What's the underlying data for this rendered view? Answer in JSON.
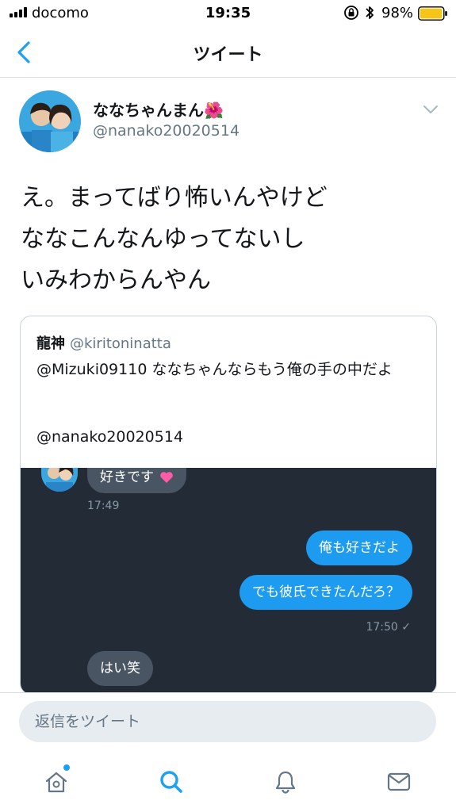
{
  "status_bar": {
    "carrier": "docomo",
    "time": "19:35",
    "battery": "98%",
    "battery_level": 0.98,
    "icons": [
      "signal-icon",
      "lock-rotation-icon",
      "bluetooth-icon",
      "battery-icon"
    ]
  },
  "nav": {
    "title": "ツイート",
    "back_icon": "chevron-left-icon"
  },
  "tweet": {
    "display_name": "ななちゃんまん🌺",
    "handle": "@nanako20020514",
    "lines": [
      "え。まってばり怖いんやけど",
      "ななこんなんゆってないし",
      "いみわからんやん"
    ]
  },
  "quote": {
    "name": "龍神",
    "handle": "@kiritoninatta",
    "text": "@Mizuki09110 ななちゃんならもう俺の手の中だよ",
    "mention": "@nanako20020514",
    "chat": {
      "messages": [
        {
          "side": "in",
          "text": "好きです"
        },
        {
          "side": "out",
          "text": "俺も好きだよ"
        },
        {
          "side": "out",
          "text": "でも彼氏できたんだろ？"
        },
        {
          "side": "in",
          "text": "はい笑"
        }
      ],
      "time_1": "17:49",
      "time_2": "17:50 ✓"
    }
  },
  "reply": {
    "placeholder": "返信をツイート"
  },
  "tabs": [
    "home-icon",
    "search-icon",
    "notifications-icon",
    "messages-icon"
  ],
  "colors": {
    "accent": "#1da1f2",
    "text": "#14171a",
    "secondary": "#657786",
    "chat_bg": "#222b36"
  }
}
